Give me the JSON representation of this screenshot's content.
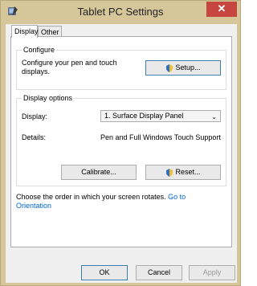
{
  "window": {
    "title": "Tablet PC Settings",
    "close_glyph": "✕"
  },
  "tabs": [
    {
      "label": "Display"
    },
    {
      "label": "Other"
    }
  ],
  "configure": {
    "group_title": "Configure",
    "description": "Configure your pen and touch displays.",
    "setup_button": "Setup..."
  },
  "display_options": {
    "group_title": "Display options",
    "display_label": "Display:",
    "display_value": "1. Surface Display Panel",
    "details_label": "Details:",
    "details_value": "Pen and Full Windows Touch Support",
    "calibrate_button": "Calibrate...",
    "reset_button": "Reset..."
  },
  "orientation": {
    "text": "Choose the order in which your screen rotates.",
    "link_prefix": "Go to",
    "link_suffix": "Orientation"
  },
  "footer": {
    "ok": "OK",
    "cancel": "Cancel",
    "apply": "Apply"
  },
  "colors": {
    "accent": "#3c7fb1",
    "link": "#0066cc",
    "titlebar": "#d6c79b",
    "close": "#c7463f"
  }
}
